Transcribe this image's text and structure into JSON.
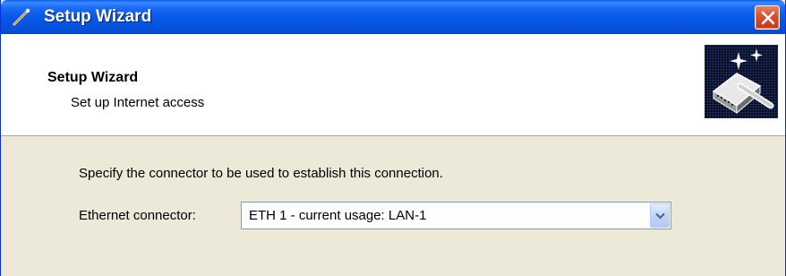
{
  "window": {
    "title": "Setup Wizard"
  },
  "header": {
    "title": "Setup Wizard",
    "subtitle": "Set up Internet access",
    "image_icon": "wizard-wand-router-icon"
  },
  "body": {
    "instruction": "Specify the connector to be used to establish this connection.",
    "connector_label": "Ethernet connector:",
    "connector_select": {
      "value": "ETH 1 - current usage: LAN-1"
    }
  },
  "colors": {
    "titlebar": "#0A5BE8",
    "close_button": "#D5502E",
    "dialog_bg": "#ECE9D8",
    "header_bg": "#FFFFFF",
    "select_border": "#7F9DB9"
  }
}
